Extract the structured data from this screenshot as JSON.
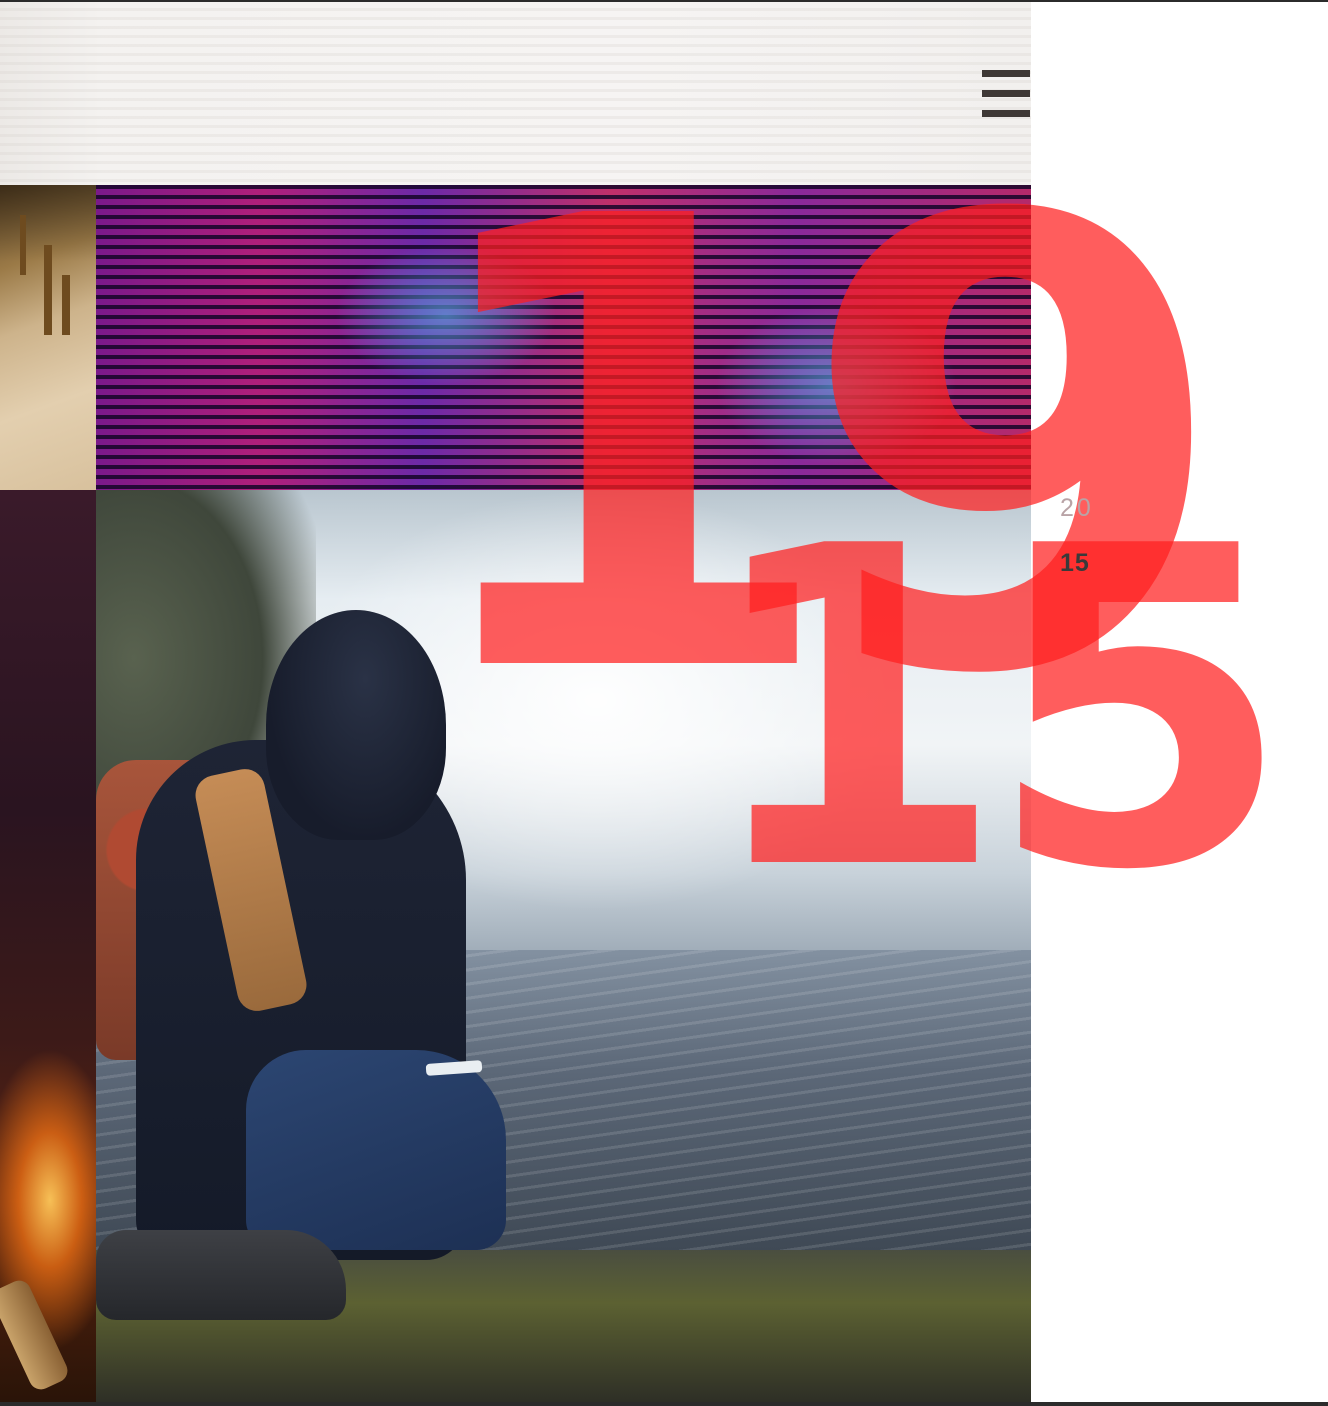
{
  "hero": {
    "digits_top": "19",
    "digits_bottom": "15",
    "accent_color": "#ff1e1e"
  },
  "nav": {
    "menu_icon": "hamburger-menu-icon"
  },
  "year_selector": {
    "items": [
      {
        "label": "20",
        "active": false
      },
      {
        "label": "15",
        "active": true
      }
    ]
  },
  "photos": [
    {
      "name": "cafe-chairs-photo"
    },
    {
      "name": "abstract-stripes-photo"
    },
    {
      "name": "campfire-photo"
    },
    {
      "name": "hiker-waterfall-photo"
    }
  ]
}
